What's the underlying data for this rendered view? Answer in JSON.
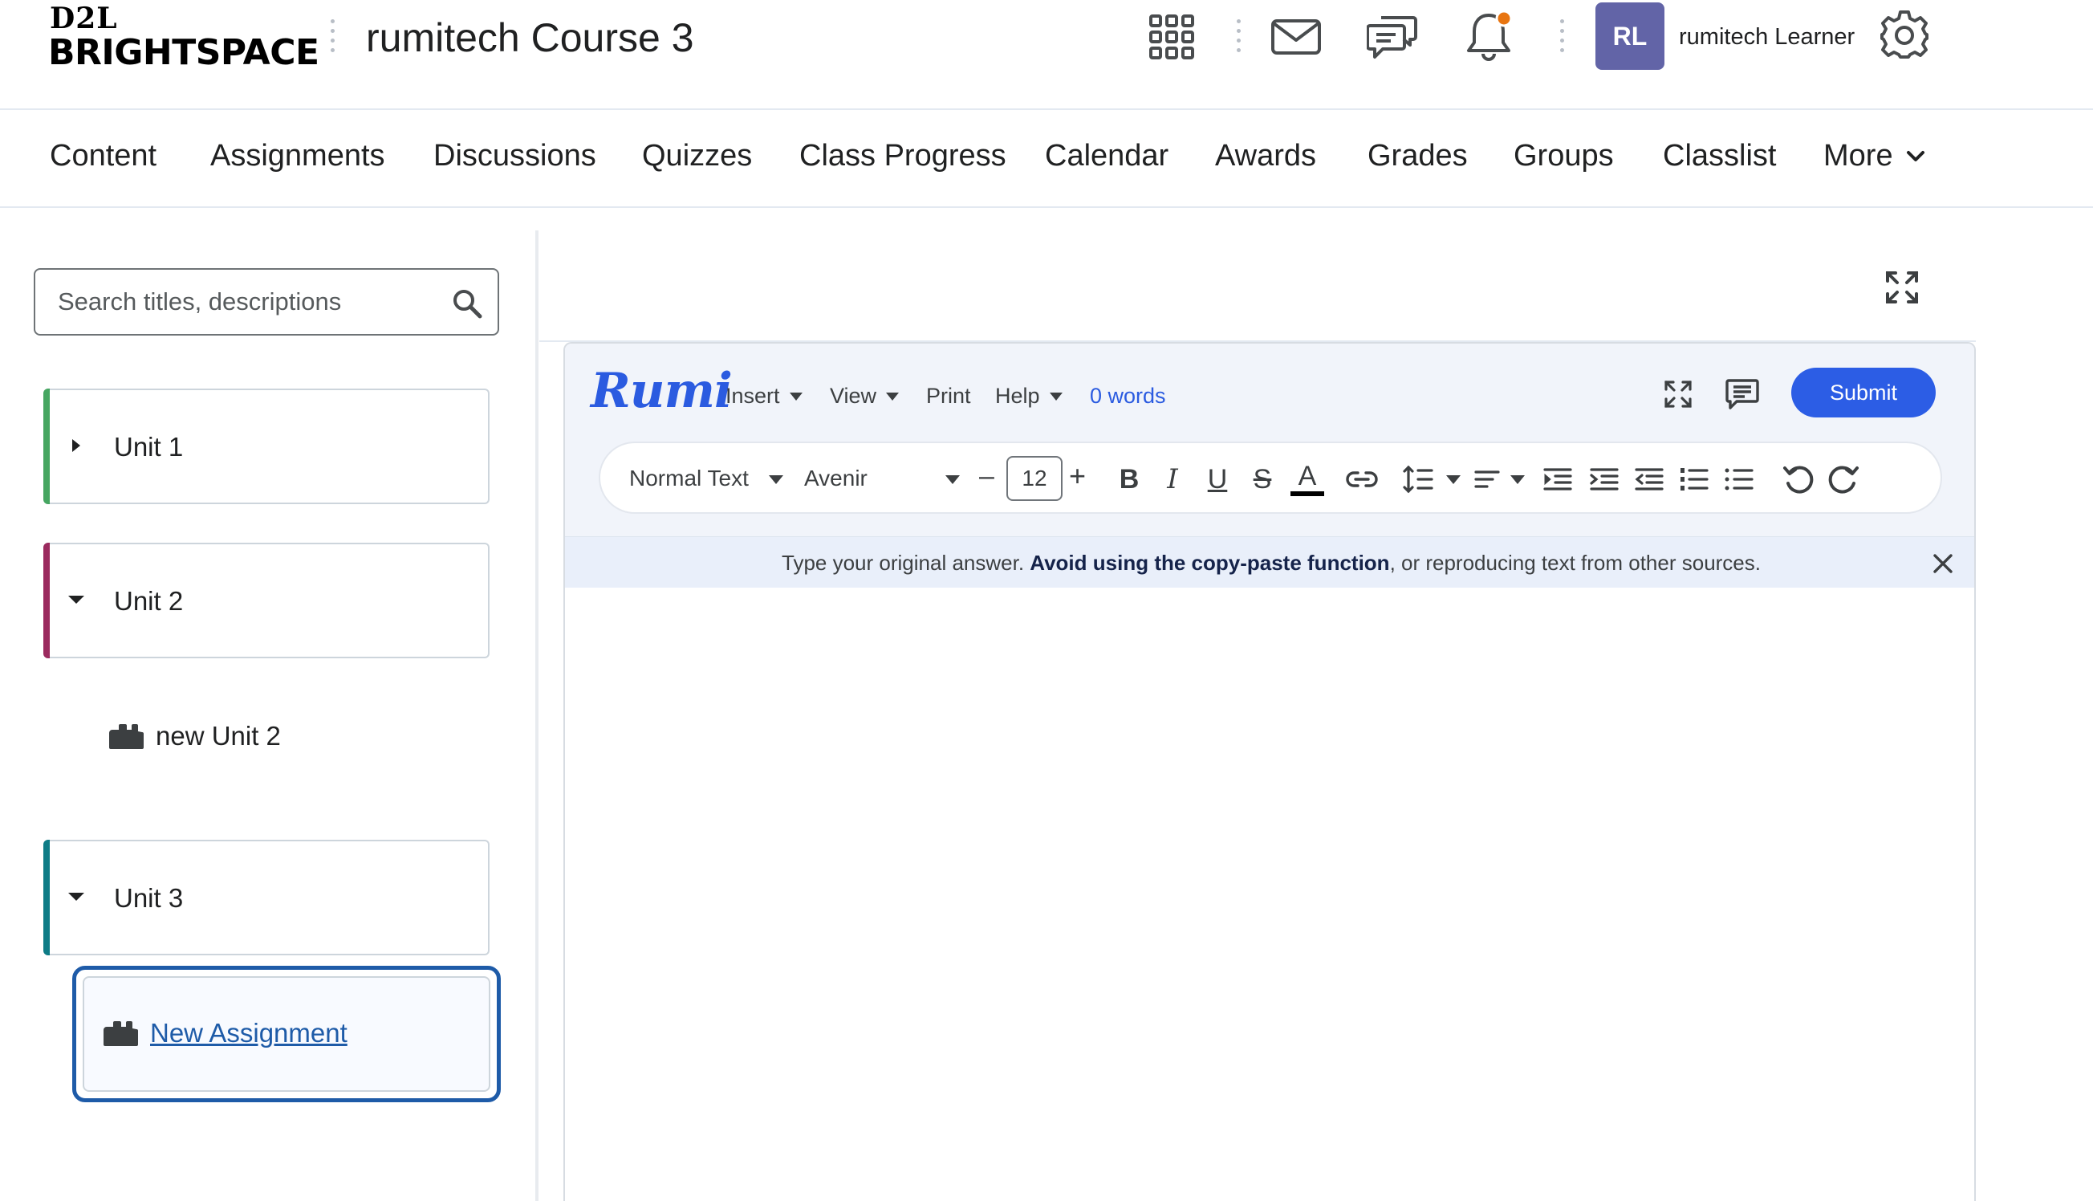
{
  "header": {
    "logo_top": "D2L",
    "logo_bottom": "BRIGHTSPACE",
    "course_title": "rumitech Course 3",
    "user_initials": "RL",
    "user_name": "rumitech Learner"
  },
  "nav": {
    "items": [
      "Content",
      "Assignments",
      "Discussions",
      "Quizzes",
      "Class Progress",
      "Calendar",
      "Awards",
      "Grades",
      "Groups",
      "Classlist"
    ],
    "more_label": "More"
  },
  "sidebar": {
    "search_placeholder": "Search titles, descriptions",
    "units": [
      {
        "label": "Unit 1",
        "accent": "#46a661",
        "expanded": false
      },
      {
        "label": "Unit 2",
        "accent": "#9b2a5e",
        "expanded": true
      },
      {
        "label": "Unit 3",
        "accent": "#0e7c86",
        "expanded": true
      }
    ],
    "topics": [
      {
        "label": "new Unit 2"
      },
      {
        "label": "New Assignment",
        "selected": true
      }
    ]
  },
  "editor": {
    "brand": "Rumi",
    "menu": [
      "Insert",
      "View",
      "Print",
      "Help"
    ],
    "word_count": "0 words",
    "submit_label": "Submit",
    "toolbar": {
      "block_style": "Normal Text",
      "font_family": "Avenir",
      "font_size": "12",
      "decrease": "–",
      "increase": "+",
      "bold": "B",
      "italic": "I",
      "underline": "U",
      "strike": "S",
      "text_color_letter": "A"
    },
    "notice": {
      "prefix": "Type your original answer.",
      "emphasis": "Avoid using the copy-paste function",
      "suffix": ", or reproducing text from other sources."
    }
  },
  "colors": {
    "accent_blue": "#2c5de5",
    "selected_border": "#1e5ba8",
    "avatar_bg": "#6264a7",
    "notification_dot": "#e87511"
  }
}
